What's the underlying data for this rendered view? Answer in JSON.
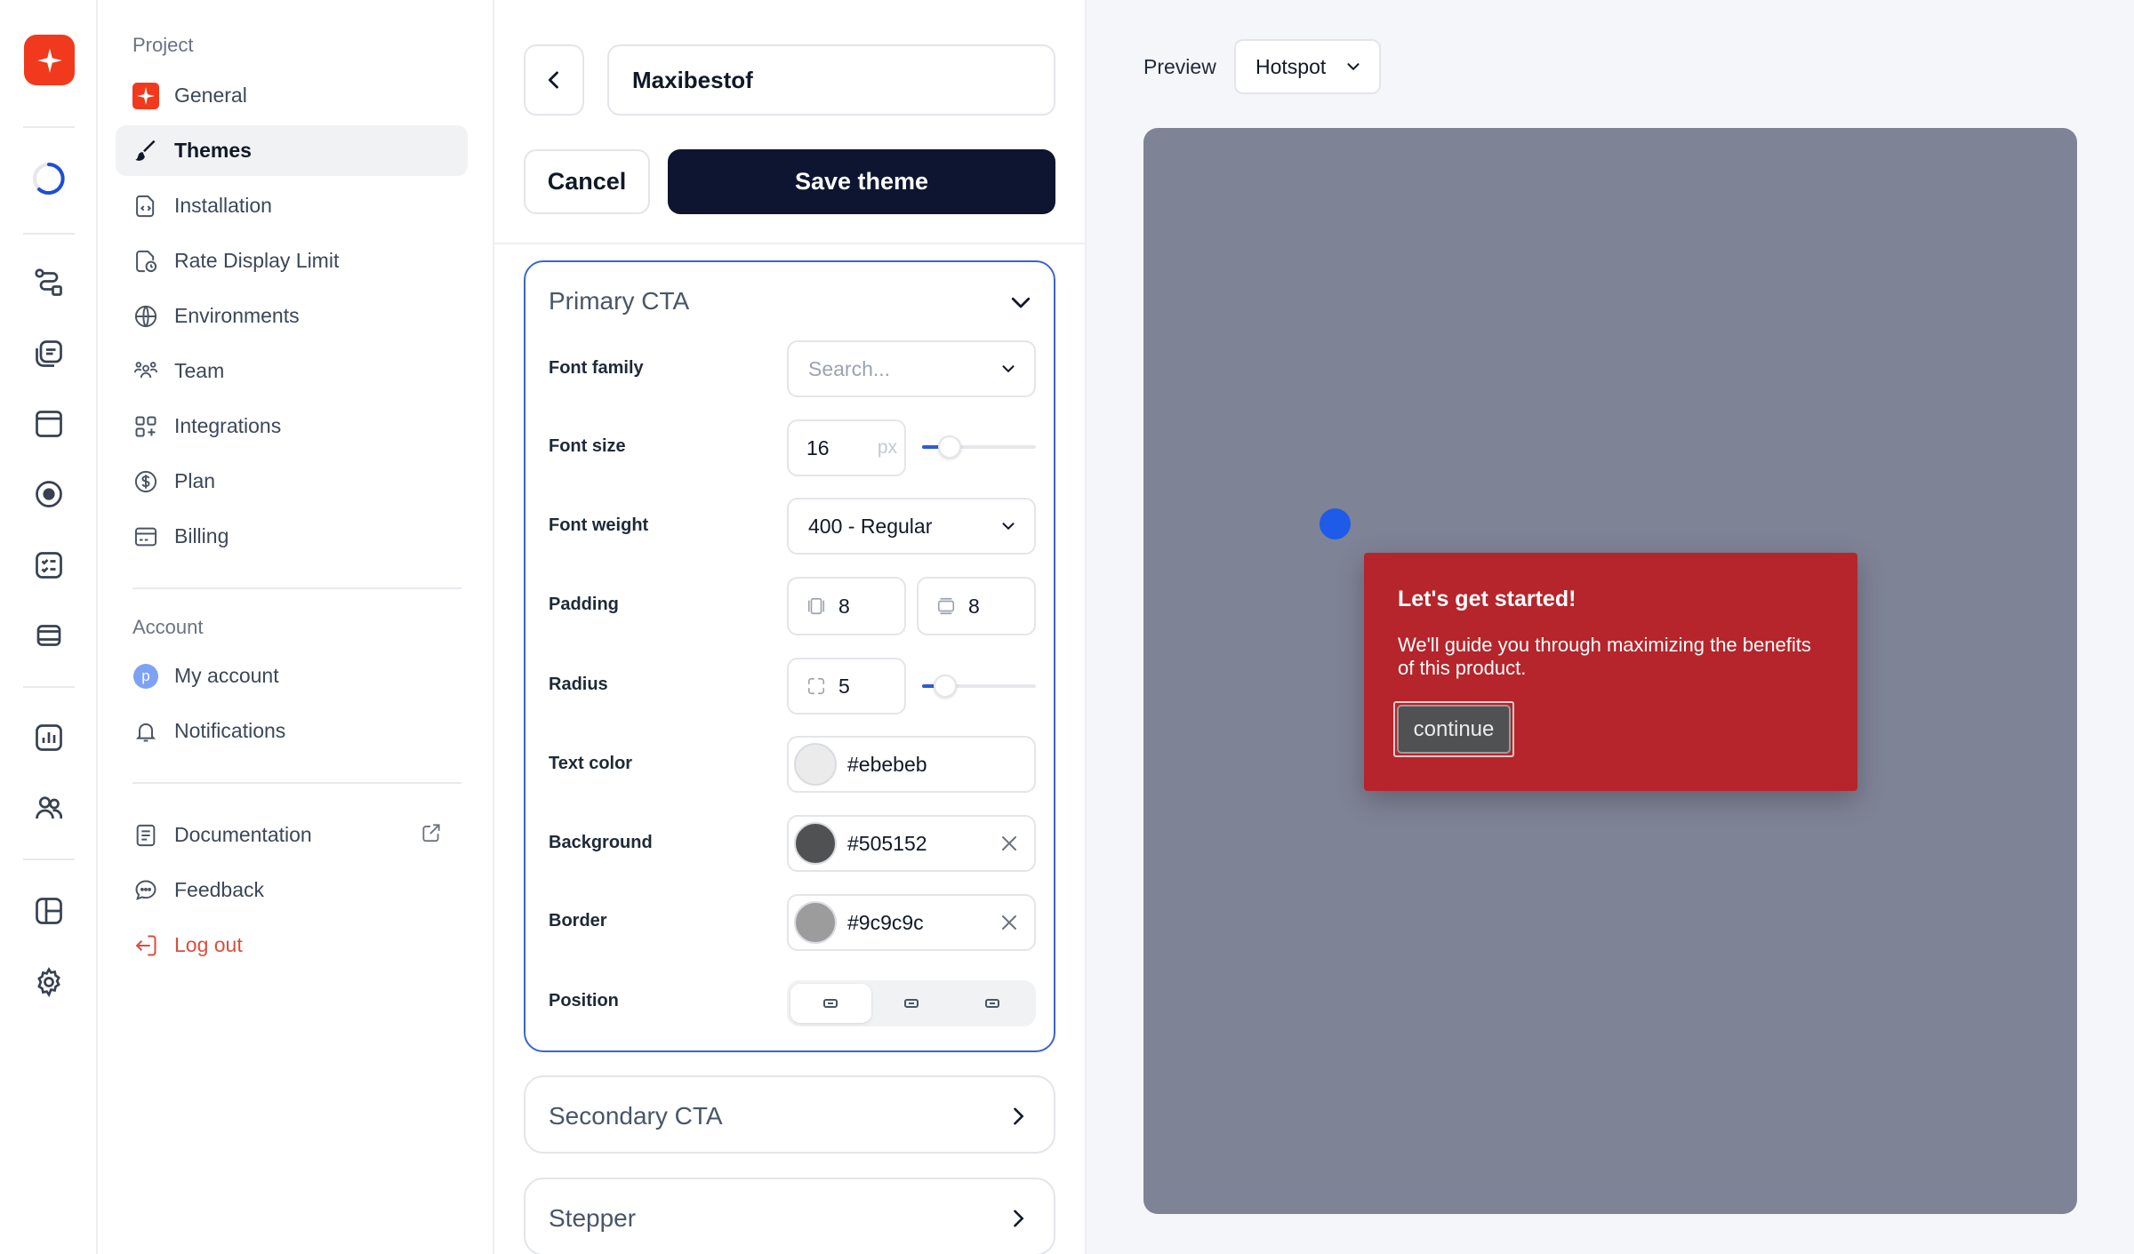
{
  "nav": {
    "project_title": "Project",
    "project_items": [
      {
        "label": "General",
        "icon": "brand-logo-icon"
      },
      {
        "label": "Themes",
        "icon": "brush-icon"
      },
      {
        "label": "Installation",
        "icon": "code-file-icon"
      },
      {
        "label": "Rate Display Limit",
        "icon": "timer-file-icon"
      },
      {
        "label": "Environments",
        "icon": "globe-icon"
      },
      {
        "label": "Team",
        "icon": "team-icon"
      },
      {
        "label": "Integrations",
        "icon": "grid-plus-icon"
      },
      {
        "label": "Plan",
        "icon": "dollar-icon"
      },
      {
        "label": "Billing",
        "icon": "billing-icon"
      }
    ],
    "account_title": "Account",
    "account_items": [
      {
        "label": "My account",
        "avatar": "p"
      },
      {
        "label": "Notifications",
        "icon": "bell-icon"
      }
    ],
    "footer_items": [
      {
        "label": "Documentation",
        "icon": "document-icon"
      },
      {
        "label": "Feedback",
        "icon": "chat-icon"
      },
      {
        "label": "Log out",
        "icon": "logout-icon"
      }
    ]
  },
  "editor": {
    "theme_name": "Maxibestof",
    "cancel_label": "Cancel",
    "save_label": "Save theme",
    "primary_cta": {
      "title": "Primary CTA",
      "font_family": {
        "label": "Font family",
        "placeholder": "Search..."
      },
      "font_size": {
        "label": "Font size",
        "value": "16",
        "unit": "px",
        "slider_fraction": 0.24
      },
      "font_weight": {
        "label": "Font weight",
        "value": "400 - Regular"
      },
      "padding": {
        "label": "Padding",
        "vertical": "8",
        "horizontal": "8"
      },
      "radius": {
        "label": "Radius",
        "value": "5",
        "slider_fraction": 0.2
      },
      "text_color": {
        "label": "Text color",
        "value": "#ebebeb"
      },
      "background": {
        "label": "Background",
        "value": "#505152"
      },
      "border": {
        "label": "Border",
        "value": "#9c9c9c"
      },
      "position": {
        "label": "Position",
        "options": [
          "left",
          "center",
          "right"
        ],
        "selected": "left"
      }
    },
    "secondary_cta_title": "Secondary CTA",
    "stepper_title": "Stepper"
  },
  "preview": {
    "label": "Preview",
    "mode": "Hotspot",
    "stage_color": "#7f8396",
    "hotspot_color": "#1d5be8",
    "tooltip": {
      "title": "Let's get started!",
      "body": "We'll guide you through maximizing the benefits of this product.",
      "cta_label": "continue",
      "background": "#b5252b"
    }
  },
  "colors": {
    "brand": "#f1391d",
    "primary_button": "#0d1530",
    "accent_blue": "#3b63d6",
    "logout_red": "#dc4c3e"
  }
}
